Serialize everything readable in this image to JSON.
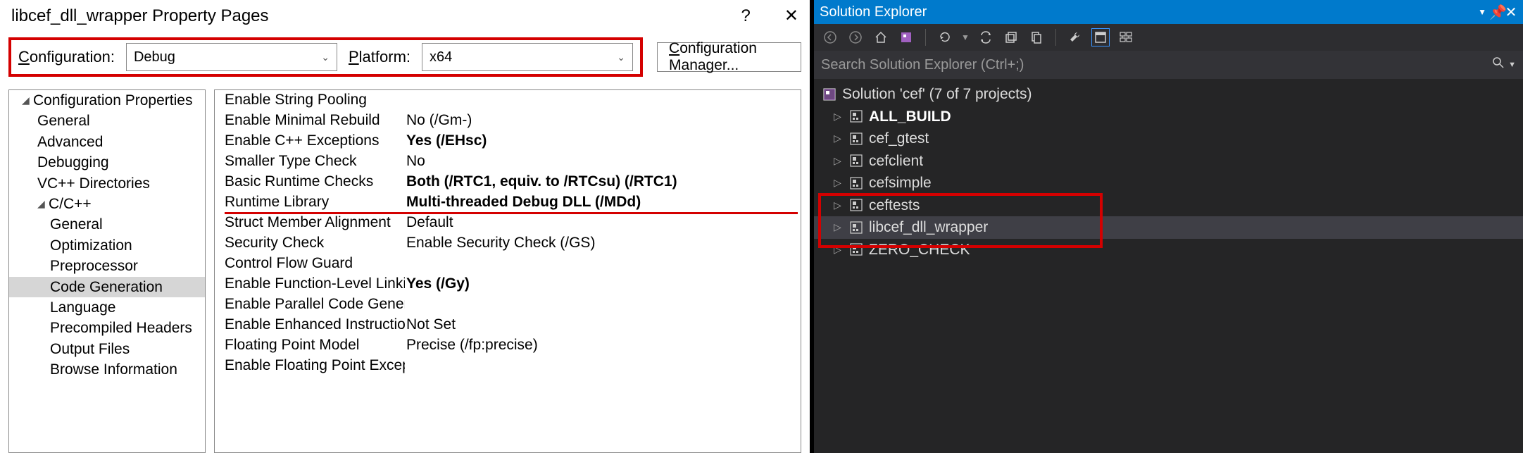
{
  "dialog": {
    "title": "libcef_dll_wrapper Property Pages",
    "help": "?",
    "close": "✕"
  },
  "config_row": {
    "config_label_pre": "C",
    "config_label_post": "onfiguration:",
    "config_value": "Debug",
    "platform_label_pre": "P",
    "platform_label_post": "latform:",
    "platform_value": "x64",
    "manager_pre": "C",
    "manager_post": "onfiguration Manager..."
  },
  "tree": [
    {
      "label": "Configuration Properties",
      "indent": 0,
      "caret": "▾"
    },
    {
      "label": "General",
      "indent": 1
    },
    {
      "label": "Advanced",
      "indent": 1
    },
    {
      "label": "Debugging",
      "indent": 1
    },
    {
      "label": "VC++ Directories",
      "indent": 1
    },
    {
      "label": "C/C++",
      "indent": 1,
      "caret": "▾"
    },
    {
      "label": "General",
      "indent": 2
    },
    {
      "label": "Optimization",
      "indent": 2
    },
    {
      "label": "Preprocessor",
      "indent": 2
    },
    {
      "label": "Code Generation",
      "indent": 2,
      "selected": true
    },
    {
      "label": "Language",
      "indent": 2
    },
    {
      "label": "Precompiled Headers",
      "indent": 2
    },
    {
      "label": "Output Files",
      "indent": 2
    },
    {
      "label": "Browse Information",
      "indent": 2
    }
  ],
  "grid": [
    {
      "name": "Enable String Pooling",
      "value": ""
    },
    {
      "name": "Enable Minimal Rebuild",
      "value": "No (/Gm-)"
    },
    {
      "name": "Enable C++ Exceptions",
      "value": "Yes (/EHsc)",
      "bold": true
    },
    {
      "name": "Smaller Type Check",
      "value": "No"
    },
    {
      "name": "Basic Runtime Checks",
      "value": "Both (/RTC1, equiv. to /RTCsu) (/RTC1)",
      "bold": true
    },
    {
      "name": "Runtime Library",
      "value": "Multi-threaded Debug DLL (/MDd)",
      "bold": true,
      "underline": true
    },
    {
      "name": "Struct Member Alignment",
      "value": "Default"
    },
    {
      "name": "Security Check",
      "value": "Enable Security Check (/GS)"
    },
    {
      "name": "Control Flow Guard",
      "value": ""
    },
    {
      "name": "Enable Function-Level Linking",
      "value": "Yes (/Gy)",
      "bold": true
    },
    {
      "name": "Enable Parallel Code Generation",
      "value": ""
    },
    {
      "name": "Enable Enhanced Instruction Set",
      "value": "Not Set"
    },
    {
      "name": "Floating Point Model",
      "value": "Precise (/fp:precise)"
    },
    {
      "name": "Enable Floating Point Exception",
      "value": ""
    }
  ],
  "solution_explorer": {
    "title": "Solution Explorer",
    "search_placeholder": "Search Solution Explorer (Ctrl+;)",
    "root": "Solution 'cef' (7 of 7 projects)",
    "projects": [
      {
        "name": "ALL_BUILD",
        "bold": true
      },
      {
        "name": "cef_gtest"
      },
      {
        "name": "cefclient"
      },
      {
        "name": "cefsimple"
      },
      {
        "name": "ceftests"
      },
      {
        "name": "libcef_dll_wrapper",
        "selected": true
      },
      {
        "name": "ZERO_CHECK"
      }
    ]
  }
}
